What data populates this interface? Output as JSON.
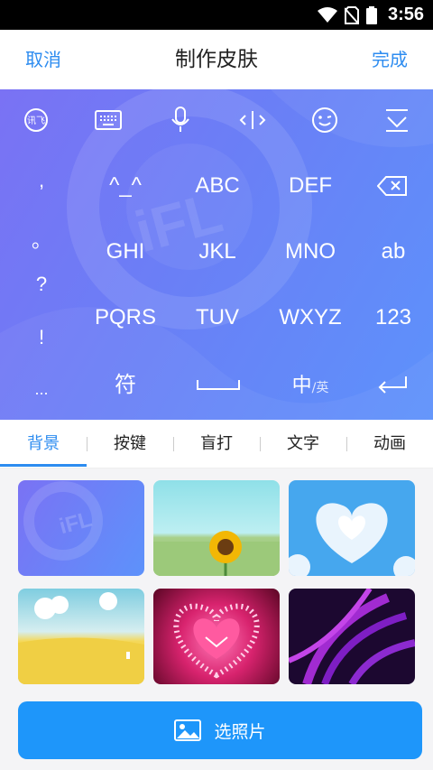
{
  "status_bar": {
    "time": "3:56"
  },
  "header": {
    "cancel_label": "取消",
    "title": "制作皮肤",
    "done_label": "完成"
  },
  "keyboard": {
    "watermark": "iFL",
    "punctuation": [
      ",",
      "。",
      "?",
      "!",
      "..."
    ],
    "rows": [
      [
        "^_^",
        "ABC",
        "DEF"
      ],
      [
        "GHI",
        "JKL",
        "MNO",
        "ab"
      ],
      [
        "PQRS",
        "TUV",
        "WXYZ",
        "123"
      ]
    ],
    "symbol_key": "符",
    "lang_key_main": "中",
    "lang_key_sub": "/英",
    "toolbar_icons": [
      "iflytek-logo-icon",
      "keyboard-icon",
      "microphone-icon",
      "cursor-move-icon",
      "emoji-icon",
      "hide-keyboard-icon"
    ]
  },
  "tabs": [
    {
      "label": "背景",
      "active": true
    },
    {
      "label": "按键",
      "active": false
    },
    {
      "label": "盲打",
      "active": false
    },
    {
      "label": "文字",
      "active": false
    },
    {
      "label": "动画",
      "active": false
    }
  ],
  "backgrounds": [
    {
      "name": "ifly-blue",
      "watermark": "iFL"
    },
    {
      "name": "sunflower-field"
    },
    {
      "name": "cloud-heart-sky"
    },
    {
      "name": "yellow-meadow"
    },
    {
      "name": "pink-heart-sparkle"
    },
    {
      "name": "purple-feathers"
    }
  ],
  "bottom": {
    "pick_photo_label": "选照片"
  },
  "colors": {
    "accent": "#2d8cf0",
    "button": "#1e96fa"
  }
}
